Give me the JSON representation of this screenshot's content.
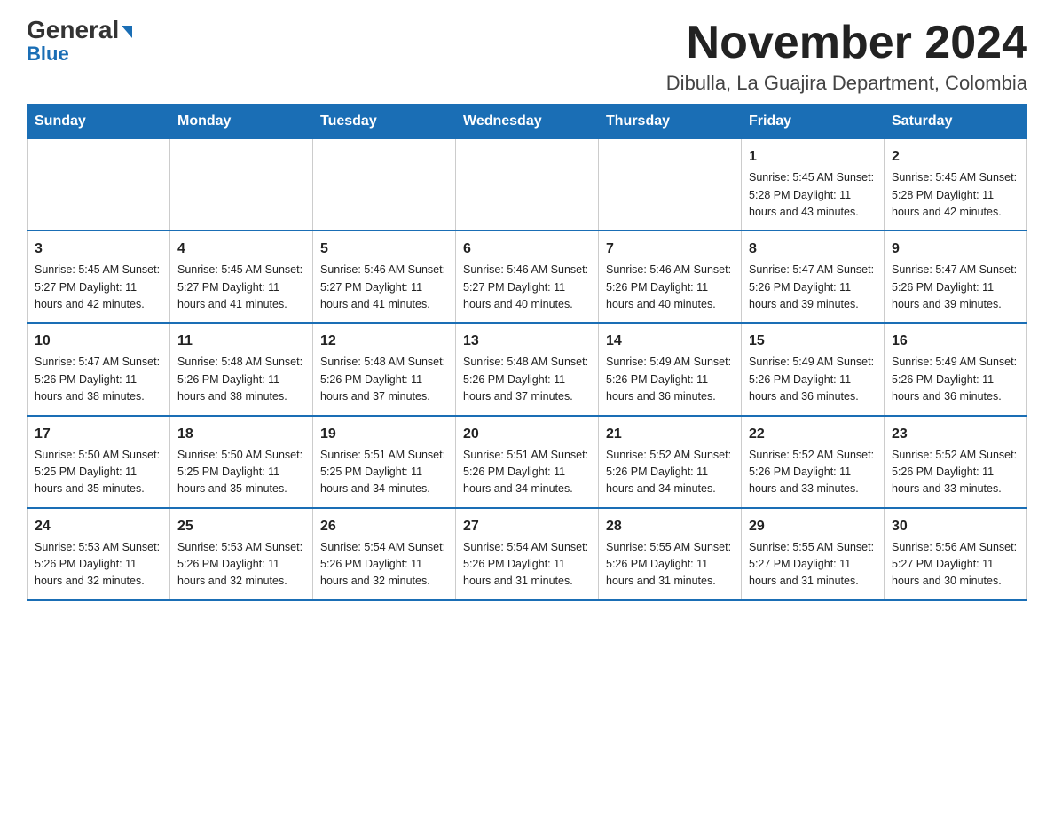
{
  "logo": {
    "part1": "General",
    "part2": "Blue"
  },
  "header": {
    "month_year": "November 2024",
    "location": "Dibulla, La Guajira Department, Colombia"
  },
  "weekdays": [
    "Sunday",
    "Monday",
    "Tuesday",
    "Wednesday",
    "Thursday",
    "Friday",
    "Saturday"
  ],
  "weeks": [
    [
      {
        "day": "",
        "info": ""
      },
      {
        "day": "",
        "info": ""
      },
      {
        "day": "",
        "info": ""
      },
      {
        "day": "",
        "info": ""
      },
      {
        "day": "",
        "info": ""
      },
      {
        "day": "1",
        "info": "Sunrise: 5:45 AM\nSunset: 5:28 PM\nDaylight: 11 hours and 43 minutes."
      },
      {
        "day": "2",
        "info": "Sunrise: 5:45 AM\nSunset: 5:28 PM\nDaylight: 11 hours and 42 minutes."
      }
    ],
    [
      {
        "day": "3",
        "info": "Sunrise: 5:45 AM\nSunset: 5:27 PM\nDaylight: 11 hours and 42 minutes."
      },
      {
        "day": "4",
        "info": "Sunrise: 5:45 AM\nSunset: 5:27 PM\nDaylight: 11 hours and 41 minutes."
      },
      {
        "day": "5",
        "info": "Sunrise: 5:46 AM\nSunset: 5:27 PM\nDaylight: 11 hours and 41 minutes."
      },
      {
        "day": "6",
        "info": "Sunrise: 5:46 AM\nSunset: 5:27 PM\nDaylight: 11 hours and 40 minutes."
      },
      {
        "day": "7",
        "info": "Sunrise: 5:46 AM\nSunset: 5:26 PM\nDaylight: 11 hours and 40 minutes."
      },
      {
        "day": "8",
        "info": "Sunrise: 5:47 AM\nSunset: 5:26 PM\nDaylight: 11 hours and 39 minutes."
      },
      {
        "day": "9",
        "info": "Sunrise: 5:47 AM\nSunset: 5:26 PM\nDaylight: 11 hours and 39 minutes."
      }
    ],
    [
      {
        "day": "10",
        "info": "Sunrise: 5:47 AM\nSunset: 5:26 PM\nDaylight: 11 hours and 38 minutes."
      },
      {
        "day": "11",
        "info": "Sunrise: 5:48 AM\nSunset: 5:26 PM\nDaylight: 11 hours and 38 minutes."
      },
      {
        "day": "12",
        "info": "Sunrise: 5:48 AM\nSunset: 5:26 PM\nDaylight: 11 hours and 37 minutes."
      },
      {
        "day": "13",
        "info": "Sunrise: 5:48 AM\nSunset: 5:26 PM\nDaylight: 11 hours and 37 minutes."
      },
      {
        "day": "14",
        "info": "Sunrise: 5:49 AM\nSunset: 5:26 PM\nDaylight: 11 hours and 36 minutes."
      },
      {
        "day": "15",
        "info": "Sunrise: 5:49 AM\nSunset: 5:26 PM\nDaylight: 11 hours and 36 minutes."
      },
      {
        "day": "16",
        "info": "Sunrise: 5:49 AM\nSunset: 5:26 PM\nDaylight: 11 hours and 36 minutes."
      }
    ],
    [
      {
        "day": "17",
        "info": "Sunrise: 5:50 AM\nSunset: 5:25 PM\nDaylight: 11 hours and 35 minutes."
      },
      {
        "day": "18",
        "info": "Sunrise: 5:50 AM\nSunset: 5:25 PM\nDaylight: 11 hours and 35 minutes."
      },
      {
        "day": "19",
        "info": "Sunrise: 5:51 AM\nSunset: 5:25 PM\nDaylight: 11 hours and 34 minutes."
      },
      {
        "day": "20",
        "info": "Sunrise: 5:51 AM\nSunset: 5:26 PM\nDaylight: 11 hours and 34 minutes."
      },
      {
        "day": "21",
        "info": "Sunrise: 5:52 AM\nSunset: 5:26 PM\nDaylight: 11 hours and 34 minutes."
      },
      {
        "day": "22",
        "info": "Sunrise: 5:52 AM\nSunset: 5:26 PM\nDaylight: 11 hours and 33 minutes."
      },
      {
        "day": "23",
        "info": "Sunrise: 5:52 AM\nSunset: 5:26 PM\nDaylight: 11 hours and 33 minutes."
      }
    ],
    [
      {
        "day": "24",
        "info": "Sunrise: 5:53 AM\nSunset: 5:26 PM\nDaylight: 11 hours and 32 minutes."
      },
      {
        "day": "25",
        "info": "Sunrise: 5:53 AM\nSunset: 5:26 PM\nDaylight: 11 hours and 32 minutes."
      },
      {
        "day": "26",
        "info": "Sunrise: 5:54 AM\nSunset: 5:26 PM\nDaylight: 11 hours and 32 minutes."
      },
      {
        "day": "27",
        "info": "Sunrise: 5:54 AM\nSunset: 5:26 PM\nDaylight: 11 hours and 31 minutes."
      },
      {
        "day": "28",
        "info": "Sunrise: 5:55 AM\nSunset: 5:26 PM\nDaylight: 11 hours and 31 minutes."
      },
      {
        "day": "29",
        "info": "Sunrise: 5:55 AM\nSunset: 5:27 PM\nDaylight: 11 hours and 31 minutes."
      },
      {
        "day": "30",
        "info": "Sunrise: 5:56 AM\nSunset: 5:27 PM\nDaylight: 11 hours and 30 minutes."
      }
    ]
  ]
}
